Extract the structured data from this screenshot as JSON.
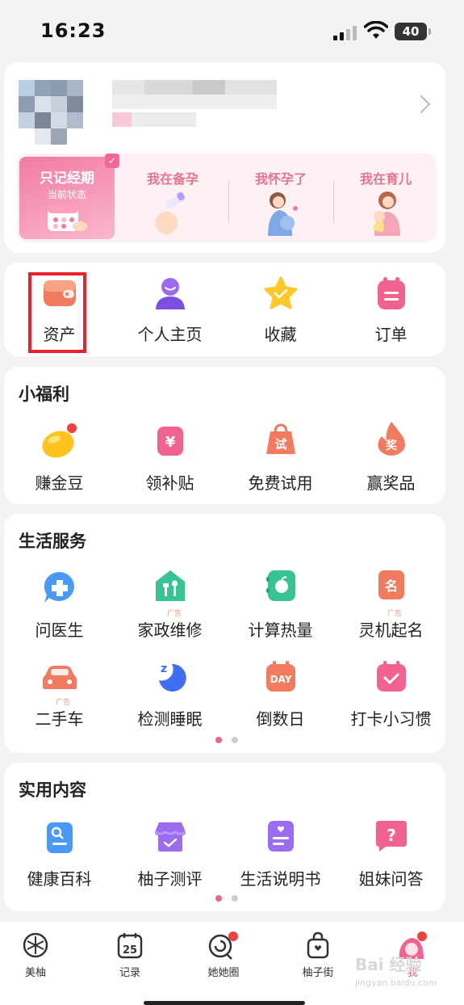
{
  "status_bar": {
    "time": "16:23",
    "battery": "40"
  },
  "profile": {
    "status_options": [
      {
        "label": "只记经期",
        "sub": "当前状态",
        "active": true
      },
      {
        "label": "我在备孕",
        "active": false
      },
      {
        "label": "我怀孕了",
        "active": false
      },
      {
        "label": "我在育儿",
        "active": false
      }
    ]
  },
  "quick": [
    {
      "label": "资产",
      "icon": "wallet-icon"
    },
    {
      "label": "个人主页",
      "icon": "person-icon"
    },
    {
      "label": "收藏",
      "icon": "star-icon"
    },
    {
      "label": "订单",
      "icon": "order-icon"
    }
  ],
  "welfare": {
    "title": "小福利",
    "items": [
      {
        "label": "赚金豆",
        "icon": "gold-bean-icon"
      },
      {
        "label": "领补贴",
        "icon": "subsidy-icon",
        "glyph": "¥"
      },
      {
        "label": "免费试用",
        "icon": "trial-icon",
        "glyph": "试"
      },
      {
        "label": "赢奖品",
        "icon": "prize-icon",
        "glyph": "奖"
      }
    ]
  },
  "life": {
    "title": "生活服务",
    "ad_label": "广告",
    "items": [
      {
        "label": "问医生",
        "icon": "doctor-chat-icon"
      },
      {
        "label": "家政维修",
        "icon": "repair-icon"
      },
      {
        "label": "计算热量",
        "icon": "calorie-icon"
      },
      {
        "label": "灵机起名",
        "icon": "naming-icon",
        "glyph": "名"
      },
      {
        "label": "二手车",
        "icon": "car-icon"
      },
      {
        "label": "检测睡眠",
        "icon": "sleep-icon",
        "glyph": "z"
      },
      {
        "label": "倒数日",
        "icon": "countdown-icon",
        "glyph": "DAY"
      },
      {
        "label": "打卡小习惯",
        "icon": "check-in-icon"
      }
    ]
  },
  "content": {
    "title": "实用内容",
    "items": [
      {
        "label": "健康百科",
        "icon": "encyclopedia-icon"
      },
      {
        "label": "柚子测评",
        "icon": "review-icon"
      },
      {
        "label": "生活说明书",
        "icon": "manual-icon"
      },
      {
        "label": "姐妹问答",
        "icon": "qa-icon",
        "glyph": "?"
      }
    ]
  },
  "tabs": [
    {
      "label": "美柚",
      "icon": "pomelo-icon"
    },
    {
      "label": "记录",
      "icon": "calendar-icon",
      "glyph": "25"
    },
    {
      "label": "她她圈",
      "icon": "lollipop-icon"
    },
    {
      "label": "柚子街",
      "icon": "shopping-bag-icon"
    },
    {
      "label": "我",
      "icon": "me-avatar-icon"
    }
  ],
  "watermark": {
    "text": "Bai 经验",
    "sub": "jingyan.baidu.com"
  }
}
